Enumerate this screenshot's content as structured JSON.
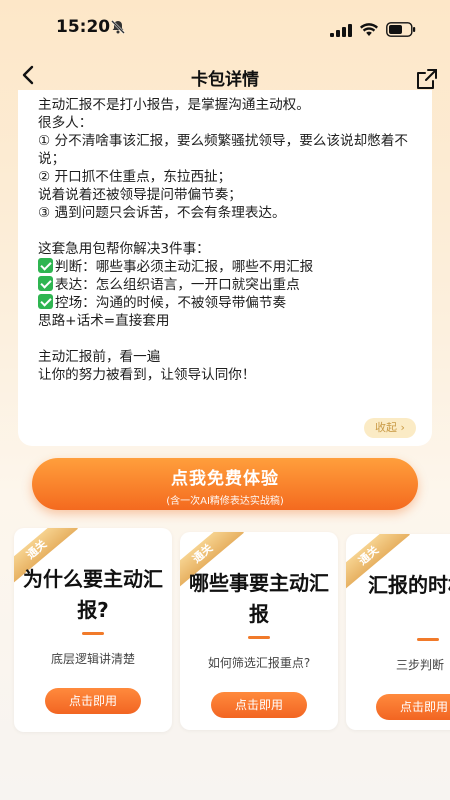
{
  "status_bar": {
    "time": "15:20"
  },
  "nav": {
    "title": "卡包详情"
  },
  "description": {
    "text": "主动汇报不是打小报告，是掌握沟通主动权。\n很多人：\n① 分不清啥事该汇报，要么频繁骚扰领导，要么该说却憋着不说；\n② 开口抓不住重点，东拉西扯；\n说着说着还被领导提问带偏节奏；\n③ 遇到问题只会诉苦，不会有条理表达。\n\n这套急用包帮你解决3件事：",
    "checks": [
      "判断：哪些事必须主动汇报，哪些不用汇报",
      "表达：怎么组织语言，一开口就突出重点",
      "控场：沟通的时候，不被领导带偏节奏"
    ],
    "tail": "思路+话术=直接套用\n\n主动汇报前，看一遍\n让你的努力被看到，让领导认同你！",
    "collapse_label": "收起 ›"
  },
  "cta": {
    "main": "点我免费体验",
    "sub": "(含一次AI精修表达实战稿)"
  },
  "cards": [
    {
      "ribbon": "通关",
      "title": "为什么要主动汇报?",
      "desc": "底层逻辑讲清楚",
      "button": "点击即用"
    },
    {
      "ribbon": "通关",
      "title": "哪些事要主动汇报",
      "desc": "如何筛选汇报重点?",
      "button": "点击即用"
    },
    {
      "ribbon": "通关",
      "title": "汇报的时机选择",
      "desc": "三步判断",
      "button": "点击即用"
    }
  ],
  "icons": [
    "mute-icon",
    "signal-icon",
    "wifi-icon",
    "battery-icon",
    "back-icon",
    "share-icon",
    "checkmark-icon"
  ],
  "colors": {
    "accent": "#f46a1f",
    "check_green": "#2fb551",
    "ribbon_gold": "#e7b162"
  }
}
